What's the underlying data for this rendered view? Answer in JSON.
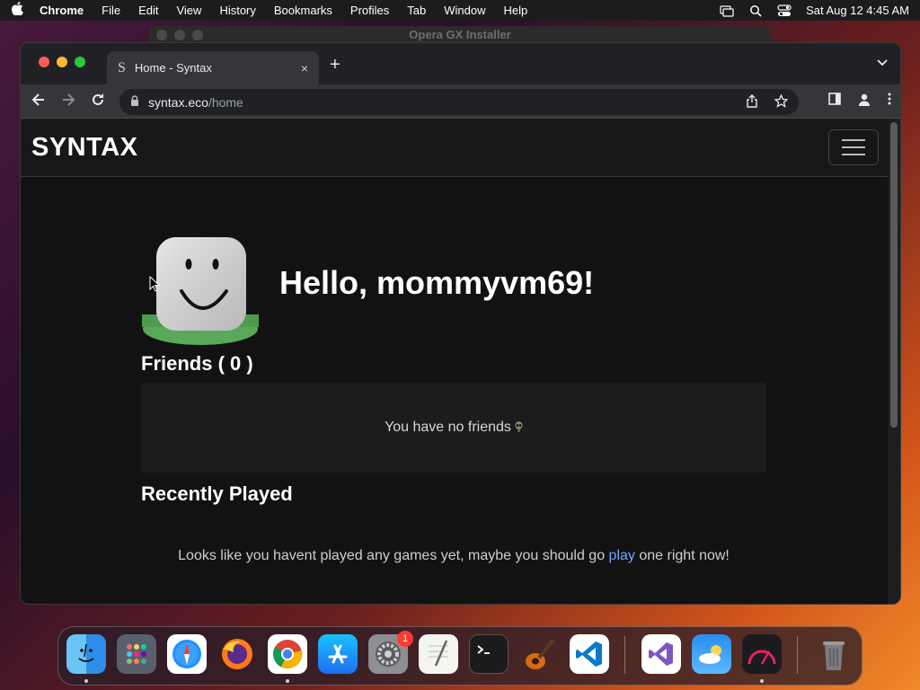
{
  "menubar": {
    "app_name": "Chrome",
    "items": [
      "File",
      "Edit",
      "View",
      "History",
      "Bookmarks",
      "Profiles",
      "Tab",
      "Window",
      "Help"
    ],
    "datetime": "Sat Aug 12  4:45 AM"
  },
  "background_window": {
    "title": "Opera GX Installer"
  },
  "browser": {
    "tab": {
      "favicon": "S",
      "title": "Home - Syntax",
      "close": "×"
    },
    "newtab": "+",
    "url_host": "syntax.eco",
    "url_path": "/home"
  },
  "site": {
    "brand": "SYNTAX",
    "greeting": "Hello, mommyvm69!",
    "friends_title": "Friends ( 0 )",
    "friends_empty": "You have no friends",
    "recent_title": "Recently Played",
    "recent_msg_before": "Looks like you havent played any games yet, maybe you should go ",
    "recent_link": "play",
    "recent_msg_after": " one right now!"
  },
  "dock": {
    "apps": [
      "finder-icon",
      "launchpad-icon",
      "safari-icon",
      "firefox-icon",
      "chrome-icon",
      "app-store-icon",
      "system-settings-icon",
      "textedit-icon",
      "terminal-icon",
      "garageband-icon",
      "vscode-icon",
      "visual-studio-icon",
      "weather-icon",
      "gauge-app-icon",
      "trash-icon"
    ],
    "settings_badge": "1"
  },
  "colors": {
    "page_bg": "#121212",
    "link": "#6ea8fe",
    "badge": "#ff3b30"
  }
}
